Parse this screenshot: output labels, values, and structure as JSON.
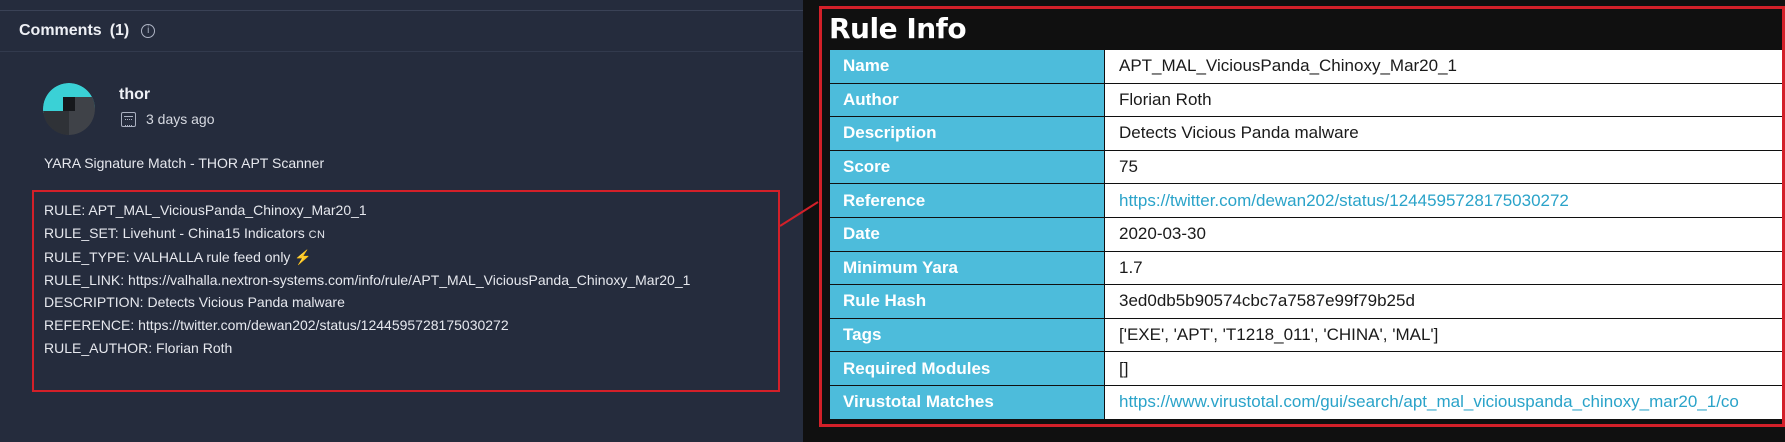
{
  "comments": {
    "header": "Comments",
    "count": "(1)",
    "info_icon": "i",
    "author": "thor",
    "timestamp": "3 days ago",
    "title": "YARA Signature Match - THOR APT Scanner",
    "lines": {
      "rule": "RULE: APT_MAL_ViciousPanda_Chinoxy_Mar20_1",
      "rule_set": "RULE_SET: Livehunt - China15 Indicators",
      "rule_set_tag": "CN",
      "rule_type": "RULE_TYPE: VALHALLA rule feed only",
      "rule_type_icon": "⚡",
      "rule_link": "RULE_LINK: https://valhalla.nextron-systems.com/info/rule/APT_MAL_ViciousPanda_Chinoxy_Mar20_1",
      "description": "DESCRIPTION: Detects Vicious Panda malware",
      "reference": "REFERENCE: https://twitter.com/dewan202/status/1244595728175030272",
      "rule_author": "RULE_AUTHOR: Florian Roth"
    }
  },
  "rule_info": {
    "heading": "Rule Info",
    "rows": [
      {
        "key": "Name",
        "value": "APT_MAL_ViciousPanda_Chinoxy_Mar20_1"
      },
      {
        "key": "Author",
        "value": "Florian Roth"
      },
      {
        "key": "Description",
        "value": "Detects Vicious Panda malware"
      },
      {
        "key": "Score",
        "value": "75"
      },
      {
        "key": "Reference",
        "value": "https://twitter.com/dewan202/status/1244595728175030272"
      },
      {
        "key": "Date",
        "value": "2020-03-30"
      },
      {
        "key": "Minimum Yara",
        "value": "1.7"
      },
      {
        "key": "Rule Hash",
        "value": "3ed0db5b90574cbc7a7587e99f79b25d"
      },
      {
        "key": "Tags",
        "value": "['EXE', 'APT', 'T1218_011', 'CHINA', 'MAL']"
      },
      {
        "key": "Required Modules",
        "value": "[]"
      },
      {
        "key": "Virustotal Matches",
        "value": "https://www.virustotal.com/gui/search/apt_mal_viciouspanda_chinoxy_mar20_1/co"
      }
    ]
  },
  "colors": {
    "highlight_border": "#d32029",
    "key_cell": "#4dbcdb",
    "link": "#2aa3c9",
    "panel_bg": "#252c3d"
  }
}
